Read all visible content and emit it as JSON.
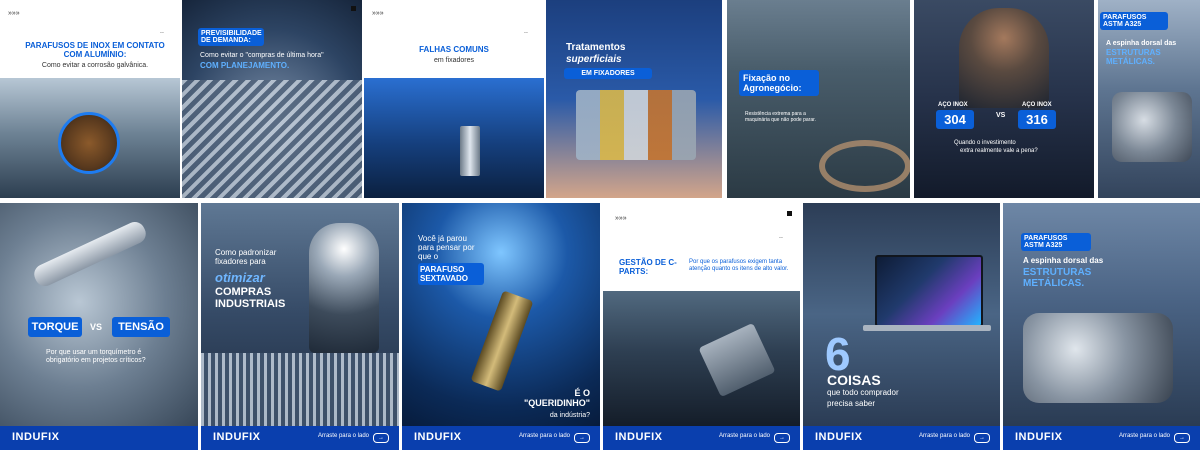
{
  "tiles": {
    "t1": {
      "title": "PARAFUSOS DE INOX EM CONTATO COM ALUMÍNIO:",
      "subtitle": "Como evitar a corrosão galvânica."
    },
    "t2": {
      "label": "PREVISIBILIDADE DE DEMANDA:",
      "line1": "Como evitar o \"compras de última hora\"",
      "line2": "COM PLANEJAMENTO."
    },
    "t3": {
      "title": "FALHAS COMUNS",
      "subtitle": "em fixadores"
    },
    "t4": {
      "line1": "Tratamentos",
      "line2": "superficiais",
      "line3": "EM FIXADORES"
    },
    "t5": {
      "title": "Fixação no Agronegócio:",
      "body": "Resistência extrema para a maquinária que não pode parar."
    },
    "t6": {
      "left_label": "AÇO INOX",
      "left_value": "304",
      "vs": "VS",
      "right_label": "AÇO INOX",
      "right_value": "316",
      "question_a": "Quando o investimento",
      "question_b": "extra realmente vale a pena?"
    },
    "t7": {
      "label": "PARAFUSOS ASTM A325",
      "line1": "A espinha dorsal das",
      "line2": "ESTRUTURAS METÁLICAS."
    },
    "t8": {
      "left": "TORQUE",
      "vs": "VS",
      "right": "TENSÃO",
      "question": "Por que usar um torquímetro é obrigatório em projetos críticos?"
    },
    "t9": {
      "line1": "Como padronizar fixadores para",
      "line2": "otimizar",
      "line3": "COMPRAS INDUSTRIAIS"
    },
    "t10": {
      "line1": "Você já parou para pensar por que o",
      "line2": "PARAFUSO SEXTAVADO",
      "line3": "É O \"QUERIDINHO\"",
      "line4": "da indústria?"
    },
    "t11": {
      "title": "GESTÃO DE C-PARTS:",
      "body": "Por que os parafusos exigem tanta atenção quanto os itens de alto valor."
    },
    "t12": {
      "number": "6",
      "title": "COISAS",
      "line1": "que todo comprador",
      "line2": "precisa saber"
    },
    "t13": {
      "label": "PARAFUSOS ASTM A325",
      "line1": "A espinha dorsal das",
      "line2": "ESTRUTURAS METÁLICAS."
    }
  },
  "footer": {
    "logo_a": "INDU",
    "logo_b": "FIX",
    "swipe": "Arraste para o lado",
    "arrow": "→"
  },
  "marks": {
    "quote": "»»»",
    "dots": ".."
  }
}
